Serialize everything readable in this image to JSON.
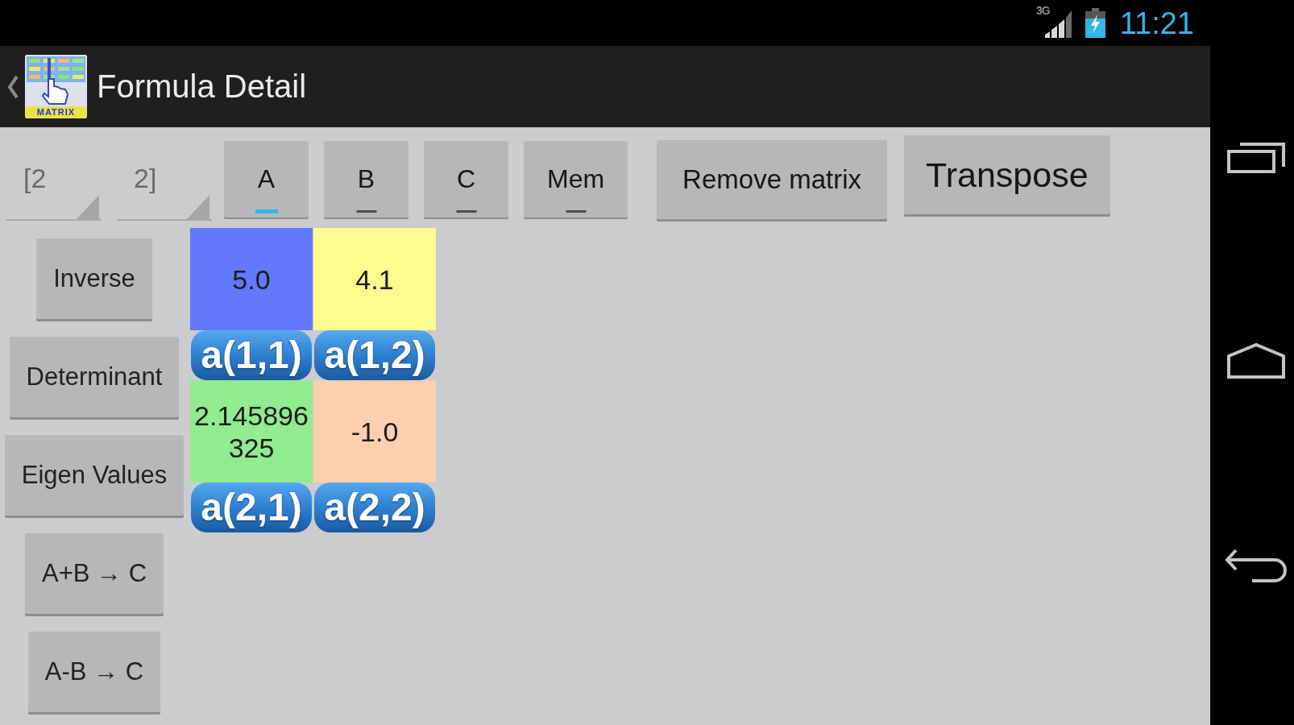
{
  "status_bar": {
    "network": "3G",
    "time": "11:21"
  },
  "action_bar": {
    "logo_text": "MATRIX",
    "title": "Formula Detail"
  },
  "dimension_spinners": [
    {
      "value": "[2"
    },
    {
      "value": "2]"
    }
  ],
  "matrix_tabs": [
    {
      "label": "A",
      "selected": true
    },
    {
      "label": "B",
      "selected": false
    },
    {
      "label": "C",
      "selected": false
    },
    {
      "label": "Mem",
      "selected": false
    }
  ],
  "toolbar_buttons": [
    {
      "kind": "regular",
      "label": "Remove matrix"
    },
    {
      "kind": "large",
      "label": "Transpose"
    }
  ],
  "operation_buttons": [
    {
      "label": "Inverse"
    },
    {
      "label": "Determinant"
    },
    {
      "label": "Eigen Values"
    },
    {
      "label": "A+B → C"
    },
    {
      "label": "A-B → C"
    }
  ],
  "matrix": {
    "rows": [
      {
        "cells": [
          {
            "value": "5.0",
            "color": "#6179fb",
            "label": "a(1,1)"
          },
          {
            "value": "4.1",
            "color": "#fbfb8e",
            "label": "a(1,2)"
          }
        ]
      },
      {
        "cells": [
          {
            "value": "2.145896325",
            "color": "#91eb8f",
            "label": "a(2,1)"
          },
          {
            "value": "-1.0",
            "color": "#fccfae",
            "label": "a(2,2)"
          }
        ]
      }
    ]
  }
}
